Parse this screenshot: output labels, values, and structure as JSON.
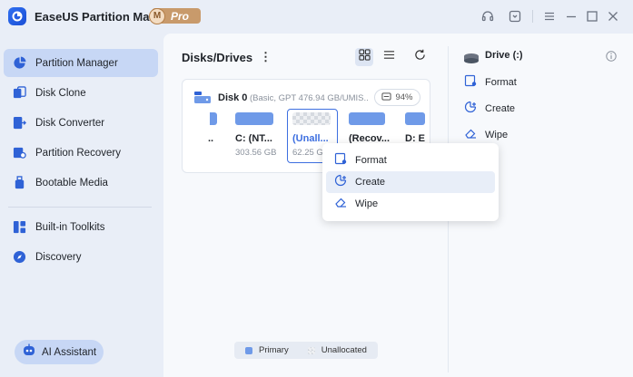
{
  "app": {
    "title": "EaseUS Partition Master",
    "badge_letter": "M",
    "badge_text": "Pro"
  },
  "colors": {
    "accent": "#3d6fe0",
    "primary_partition": "#6f9ae8",
    "sidebar_active": "#c7d7f5"
  },
  "window_controls": [
    "headset-icon",
    "feedback-icon",
    "menu-icon",
    "minimize-icon",
    "maximize-icon",
    "close-icon"
  ],
  "sidebar": {
    "items": [
      {
        "label": "Partition Manager",
        "icon": "partition-icon",
        "active": true
      },
      {
        "label": "Disk Clone",
        "icon": "clone-icon"
      },
      {
        "label": "Disk Converter",
        "icon": "converter-icon"
      },
      {
        "label": "Partition Recovery",
        "icon": "recovery-icon"
      },
      {
        "label": "Bootable Media",
        "icon": "bootable-icon"
      },
      {
        "label": "Built-in Toolkits",
        "icon": "toolkit-icon"
      },
      {
        "label": "Discovery",
        "icon": "compass-icon"
      }
    ],
    "ai_assistant": "AI Assistant"
  },
  "main": {
    "title": "Disks/Drives",
    "disk": {
      "name": "Disk 0",
      "info": "(Basic, GPT 476.94 GB/UMIS...",
      "usage": "94%",
      "partitions": [
        {
          "name": "..",
          "size": ""
        },
        {
          "name": "C: (NT...",
          "size": "303.56 GB"
        },
        {
          "name": "(Unall...",
          "size": "62.25 G"
        },
        {
          "name": "(Recov...",
          "size": ""
        },
        {
          "name": "D: E",
          "size": ""
        }
      ]
    },
    "context_menu": [
      "Format",
      "Create",
      "Wipe"
    ],
    "legend": {
      "primary": "Primary",
      "unallocated": "Unallocated"
    }
  },
  "right_panel": {
    "title": "Drive (:)",
    "actions": [
      "Format",
      "Create",
      "Wipe"
    ]
  }
}
